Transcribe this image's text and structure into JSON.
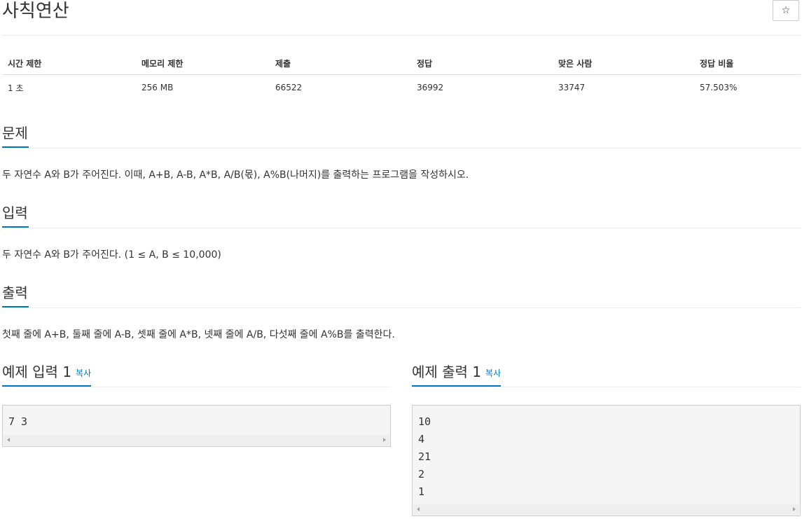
{
  "problem": {
    "title": "사칙연산",
    "star_label": "☆"
  },
  "info": {
    "headers": [
      "시간 제한",
      "메모리 제한",
      "제출",
      "정답",
      "맞은 사람",
      "정답 비율"
    ],
    "values": [
      "1 초",
      "256 MB",
      "66522",
      "36992",
      "33747",
      "57.503%"
    ]
  },
  "sections": {
    "description": {
      "heading": "문제",
      "text": "두 자연수 A와 B가 주어진다. 이때, A+B, A-B, A*B, A/B(몫), A%B(나머지)를 출력하는 프로그램을 작성하시오."
    },
    "input": {
      "heading": "입력",
      "text": "두 자연수 A와 B가 주어진다. (1 ≤ A, B ≤ 10,000)"
    },
    "output": {
      "heading": "출력",
      "text": "첫째 줄에 A+B, 둘째 줄에 A-B, 셋째 줄에 A*B, 넷째 줄에 A/B, 다섯째 줄에 A%B를 출력한다."
    }
  },
  "examples": {
    "input_heading": "예제 입력 1",
    "output_heading": "예제 출력 1",
    "copy_label": "복사",
    "input_lines": [
      "7 3"
    ],
    "output_lines": [
      "10",
      "4",
      "21",
      "2",
      "1"
    ]
  }
}
